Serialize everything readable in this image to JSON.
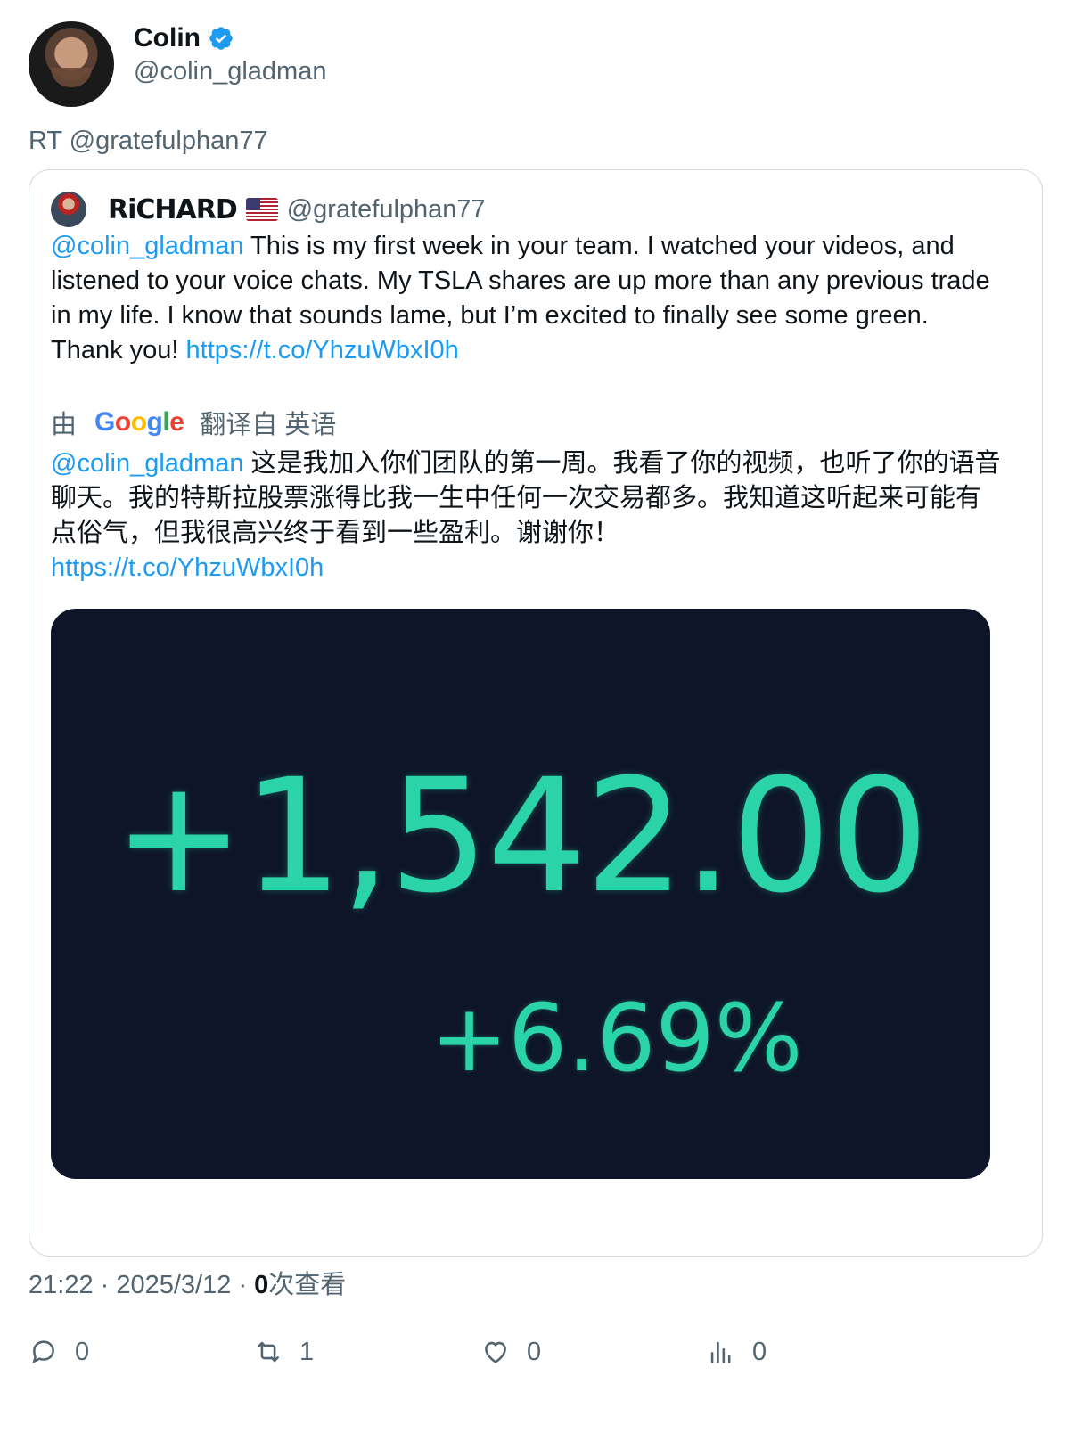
{
  "author": {
    "display_name": "Colin",
    "handle": "@colin_gladman",
    "verified": true
  },
  "retweet_label": "RT @gratefulphan77",
  "quoted": {
    "name": "RiCHARD",
    "flag": "🇺🇸",
    "handle": "@gratefulphan77",
    "mention": "@colin_gladman",
    "text": " This is my first week in your team. I watched your videos, and listened to your voice chats. My TSLA shares are up more than any previous trade in my life. I know that sounds lame, but I’m excited to finally see some green. Thank you! ",
    "link": "https://t.co/YhzuWbxI0h",
    "translation": {
      "prefix": "由",
      "brand": "Google",
      "suffix": "翻译自 英语",
      "mention": "@colin_gladman",
      "text": " 这是我加入你们团队的第一周。我看了你的视频，也听了你的语音聊天。我的特斯拉股票涨得比我一生中任何一次交易都多。我知道这听起来可能有点俗气，但我很高兴终于看到一些盈利。谢谢你！",
      "link": "https://t.co/YhzuWbxI0h"
    },
    "media": {
      "gain": "+1,542.00",
      "percent": "+6.69%",
      "accent_color": "#2bd4a8",
      "background_color": "#0e1528"
    }
  },
  "meta": {
    "time": "21:22",
    "date": "2025/3/12",
    "views_count": "0",
    "views_label": "次查看"
  },
  "actions": {
    "reply_count": "0",
    "retweet_count": "1",
    "like_count": "0",
    "views_count": "0"
  },
  "colors": {
    "link": "#1d9bf0",
    "secondary_text": "#536471",
    "verified": "#1d9bf0"
  }
}
